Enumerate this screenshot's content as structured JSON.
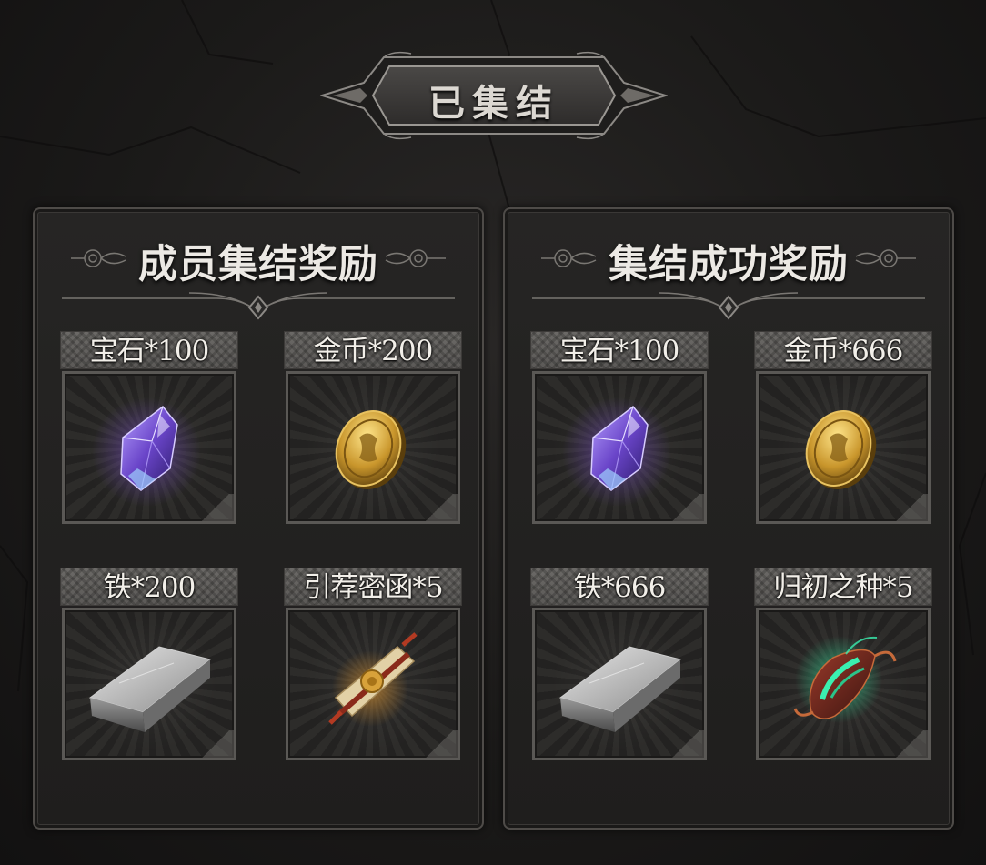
{
  "banner": {
    "title": "已集结"
  },
  "panels": [
    {
      "title": "成员集结奖励",
      "items": [
        {
          "label": "宝石*100",
          "icon": "purple-gem-icon"
        },
        {
          "label": "金币*200",
          "icon": "gold-coin-icon"
        },
        {
          "label": "铁*200",
          "icon": "iron-ingot-icon"
        },
        {
          "label": "引荐密函*5",
          "icon": "sealed-scroll-icon"
        }
      ]
    },
    {
      "title": "集结成功奖励",
      "items": [
        {
          "label": "宝石*100",
          "icon": "purple-gem-icon"
        },
        {
          "label": "金币*666",
          "icon": "gold-coin-icon"
        },
        {
          "label": "铁*666",
          "icon": "iron-ingot-icon"
        },
        {
          "label": "归初之种*5",
          "icon": "green-seed-icon"
        }
      ]
    }
  ],
  "colors": {
    "background": "#1b1a19",
    "panel_border": "#4e4b48",
    "label_bg": "#63615e",
    "text": "#ece9e4"
  }
}
